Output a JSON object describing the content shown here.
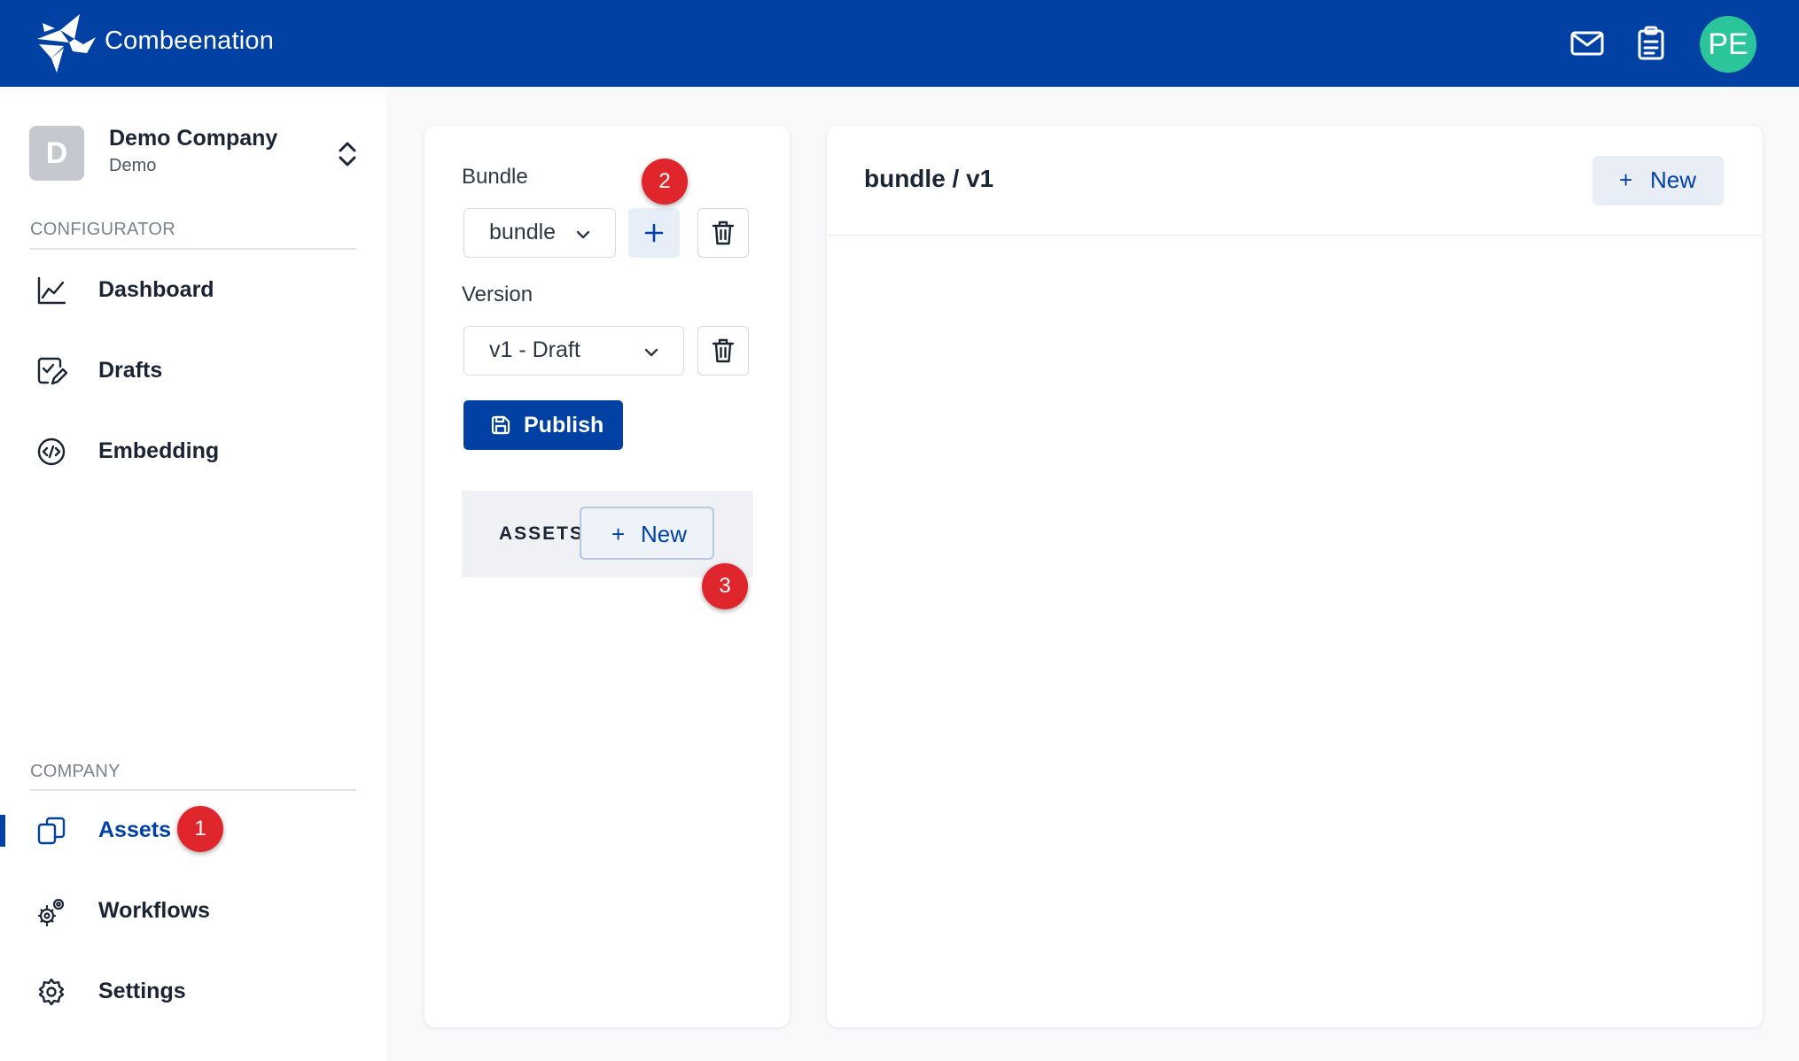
{
  "app": {
    "brand": "Combeenation",
    "user_initials": "PE",
    "colors": {
      "header": "#0041a3",
      "avatar": "#2bc59b",
      "badge": "#e0262d"
    },
    "icons": {
      "logo": "bee-logo-icon",
      "messages": "mail-icon",
      "tasks": "clipboard-icon"
    }
  },
  "sidebar": {
    "org": {
      "initial": "D",
      "name": "Demo Company",
      "sub": "Demo",
      "switch_icon": "chevron-up-down-icon"
    },
    "sections": {
      "configurator": "CONFIGURATOR",
      "company": "COMPANY"
    },
    "items": [
      {
        "label": "Dashboard",
        "icon": "chart-line-icon"
      },
      {
        "label": "Drafts",
        "icon": "edit-document-icon"
      },
      {
        "label": "Embedding",
        "icon": "code-circle-icon"
      },
      {
        "label": "Assets",
        "icon": "copy-icon",
        "active": true
      },
      {
        "label": "Workflows",
        "icon": "cogs-icon"
      },
      {
        "label": "Settings",
        "icon": "gear-icon"
      }
    ]
  },
  "bundle_panel": {
    "bundle_label": "Bundle",
    "bundle_value": "bundle",
    "version_label": "Version",
    "version_value": "v1 - Draft",
    "publish_label": "Publish",
    "assets_title": "ASSETS",
    "assets_new_label": "New",
    "plus_glyph": "+"
  },
  "main_panel": {
    "title": "bundle / v1",
    "new_label": "New",
    "plus_glyph": "+"
  },
  "badges": [
    "1",
    "2",
    "3"
  ]
}
